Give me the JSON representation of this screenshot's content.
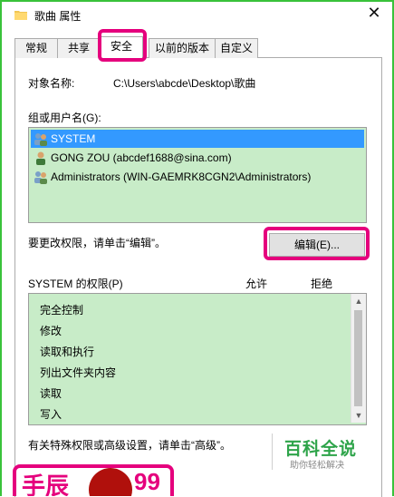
{
  "window": {
    "title": "歌曲 属性",
    "close_glyph": "✕"
  },
  "tabs": [
    {
      "label": "常规"
    },
    {
      "label": "共享"
    },
    {
      "label": "安全"
    },
    {
      "label": "以前的版本"
    },
    {
      "label": "自定义"
    }
  ],
  "active_tab": "安全",
  "object": {
    "label": "对象名称:",
    "value": "C:\\Users\\abcde\\Desktop\\歌曲"
  },
  "users": {
    "label": "组或用户名(G):",
    "items": [
      {
        "name": "SYSTEM",
        "icon": "group-icon",
        "selected": true
      },
      {
        "name": "GONG ZOU (abcdef1688@sina.com)",
        "icon": "user-icon",
        "selected": false
      },
      {
        "name": "Administrators (WIN-GAEMRK8CGN2\\Administrators)",
        "icon": "group-icon",
        "selected": false
      }
    ]
  },
  "edit": {
    "hint": "要更改权限，请单击“编辑”。",
    "button_label": "编辑(E)..."
  },
  "permissions": {
    "label": "SYSTEM 的权限(P)",
    "allow_header": "允许",
    "deny_header": "拒绝",
    "items": [
      "完全控制",
      "修改",
      "读取和执行",
      "列出文件夹内容",
      "读取",
      "写入"
    ]
  },
  "advanced_hint": "有关特殊权限或高级设置，请单击“高级”。",
  "watermark": {
    "main": "百科全说",
    "sub": "助你轻松解决"
  },
  "bottom_logo": {
    "text_left": "手辰",
    "text_right": "99"
  },
  "colors": {
    "highlight": "#e5007d",
    "list_bg": "#c8ecc8",
    "selection": "#3399ff",
    "frame": "#39c23a"
  }
}
